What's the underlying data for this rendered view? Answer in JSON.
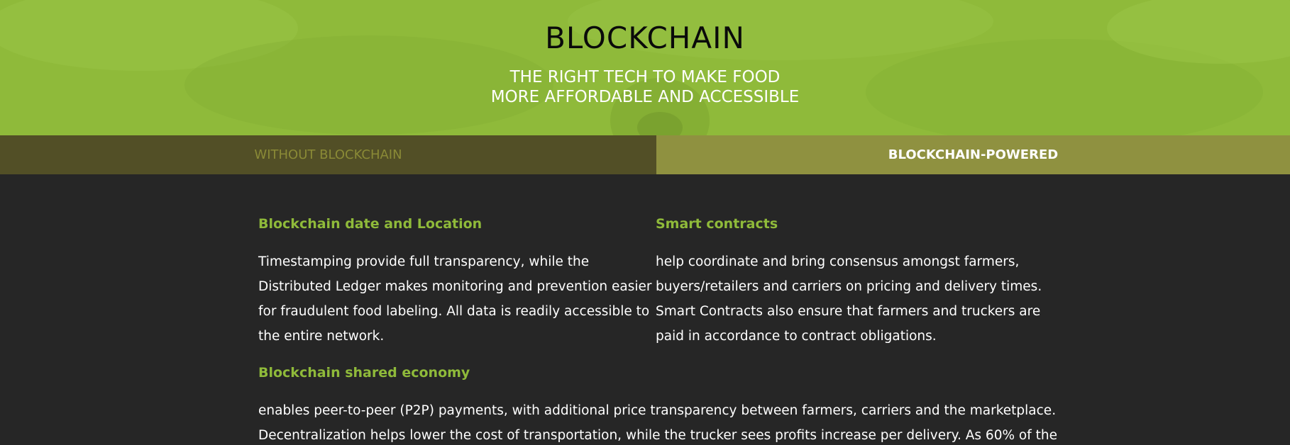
{
  "hero": {
    "title": "BLOCKCHAIN",
    "subtitle_line1": "THE RIGHT TECH TO MAKE FOOD",
    "subtitle_line2": "MORE AFFORDABLE AND ACCESSIBLE"
  },
  "tabs": [
    {
      "label": "WITHOUT BLOCKCHAIN",
      "active": false
    },
    {
      "label": "BLOCKCHAIN-POWERED",
      "active": true
    }
  ],
  "sections": {
    "date_location": {
      "heading": "Blockchain date and Location",
      "lines": [
        "Timestamping provide full transparency, while the",
        "Distributed Ledger makes monitoring and prevention easier",
        "for fraudulent food labeling. All data is readily accessible to",
        "the entire network."
      ]
    },
    "smart_contracts": {
      "heading": "Smart contracts",
      "lines": [
        "help coordinate and bring consensus amongst farmers,",
        "buyers/retailers and carriers on pricing and delivery times.",
        "Smart Contracts also ensure that farmers and truckers are",
        "paid in accordance to contract obligations."
      ]
    },
    "shared_economy": {
      "heading": "Blockchain shared economy",
      "lines": [
        "enables peer-to-peer (P2P) payments, with additional price transparency between farmers, carriers and the marketplace.",
        "Decentralization helps lower the cost of transportation, while the trucker sees profits increase per delivery.  As 60% of the"
      ]
    }
  },
  "colors": {
    "accent_green": "#8fba3a",
    "hero_bg": "#8fba3a",
    "tab_inactive_bg": "#524f26",
    "tab_active_bg": "#8f9140",
    "page_bg": "#262626"
  }
}
